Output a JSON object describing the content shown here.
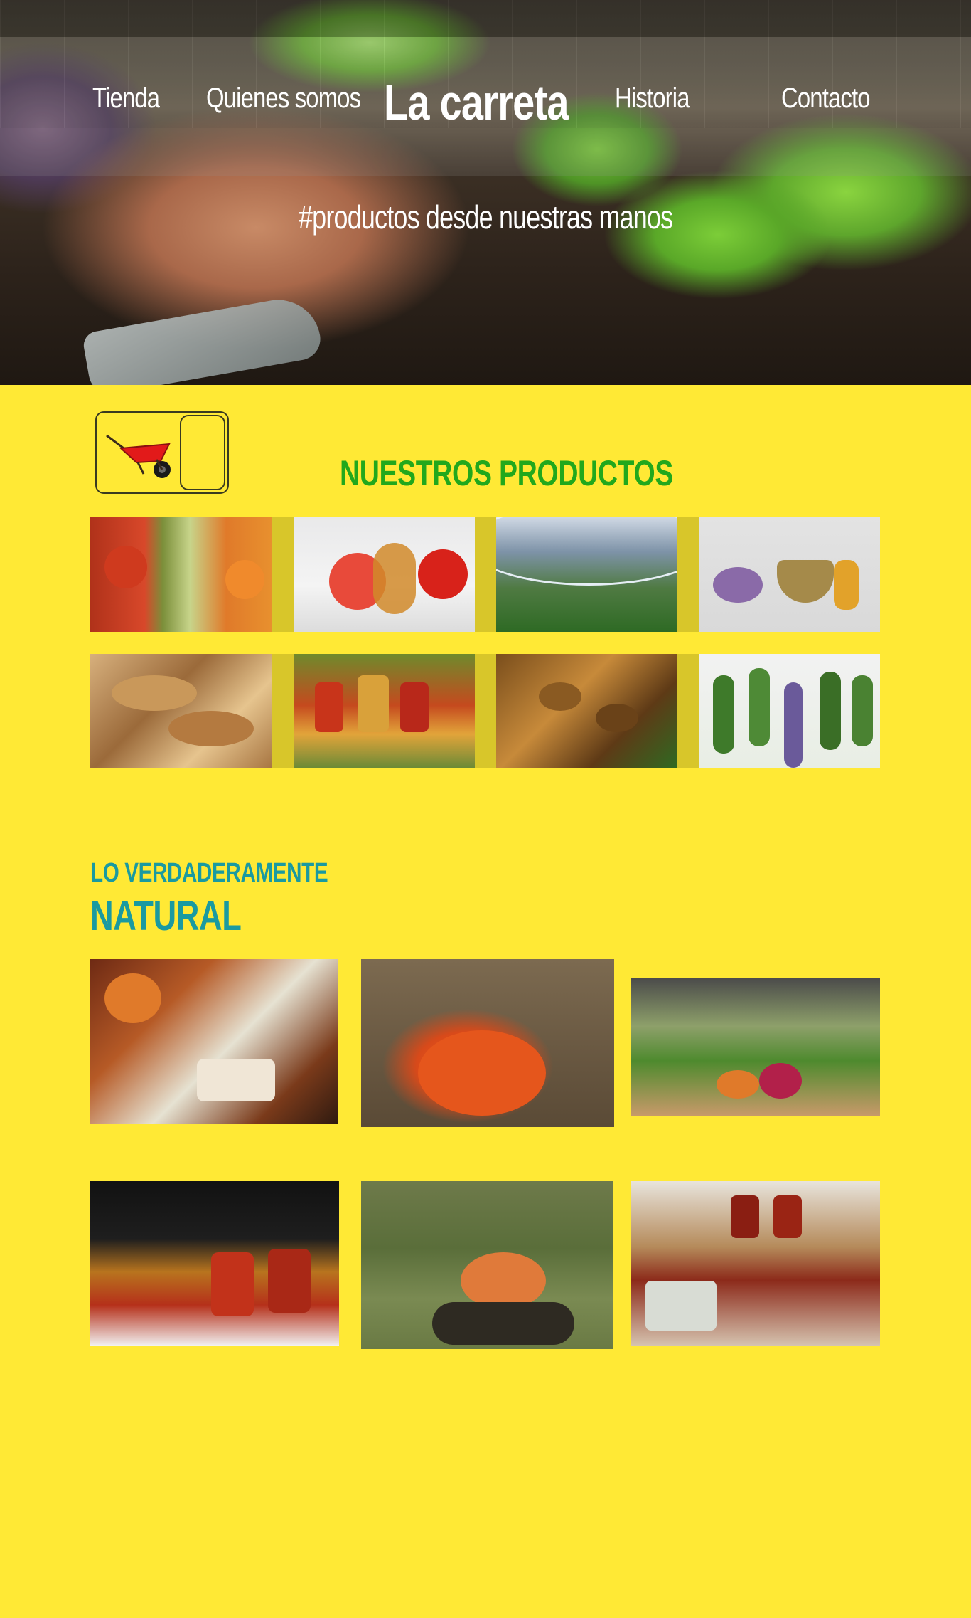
{
  "nav": {
    "left": [
      "Tienda",
      "Quienes somos"
    ],
    "brand": "La carreta",
    "right": [
      "Historia",
      "Contacto"
    ]
  },
  "hero": {
    "tagline": "#productos desde nuestras manos"
  },
  "products": {
    "title": "NUESTROS PRODUCTOS",
    "tiles": [
      "vegetables-image",
      "apple-cider-image",
      "greenhouse-image",
      "herbs-mortar-image",
      "bread-image",
      "preserves-jars-image",
      "beehive-image",
      "hanging-herbs-image"
    ]
  },
  "natural": {
    "small": "LO VERDADERAMENTE",
    "big": "NATURAL",
    "photos": [
      "market-table-photo",
      "pumpkin-field-photo",
      "vegetable-stall-photo",
      "preserves-photo",
      "pumpkin-pile-photo",
      "jam-table-photo"
    ]
  },
  "colors": {
    "background": "#ffe935",
    "products_title": "#22a81c",
    "natural_title": "#1a9aa0",
    "grid_backdrop": "#d8c62a"
  },
  "icons": {
    "logo": "wheelbarrow-icon"
  }
}
